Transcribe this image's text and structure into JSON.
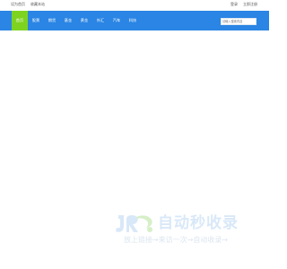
{
  "topbar": {
    "left_links": [
      "设为首页",
      "收藏本站"
    ],
    "right_links": [
      "登录",
      "立即注册"
    ]
  },
  "nav": {
    "items": [
      {
        "label": "首页",
        "active": true
      },
      {
        "label": "股票",
        "active": false
      },
      {
        "label": "期货",
        "active": false
      },
      {
        "label": "基金",
        "active": false
      },
      {
        "label": "黄金",
        "active": false
      },
      {
        "label": "外汇",
        "active": false
      },
      {
        "label": "汽车",
        "active": false
      },
      {
        "label": "科技",
        "active": false
      }
    ]
  },
  "search": {
    "placeholder": "请输入搜索内容"
  },
  "watermark": {
    "brand": "自动秒收录",
    "slogan": "放上链接→来访一次→自动收录→"
  },
  "colors": {
    "navbar": "#2a85e4",
    "active_tab": "#7ed321",
    "watermark_blue": "#d9e8f8",
    "watermark_green": "#d6efc8"
  }
}
